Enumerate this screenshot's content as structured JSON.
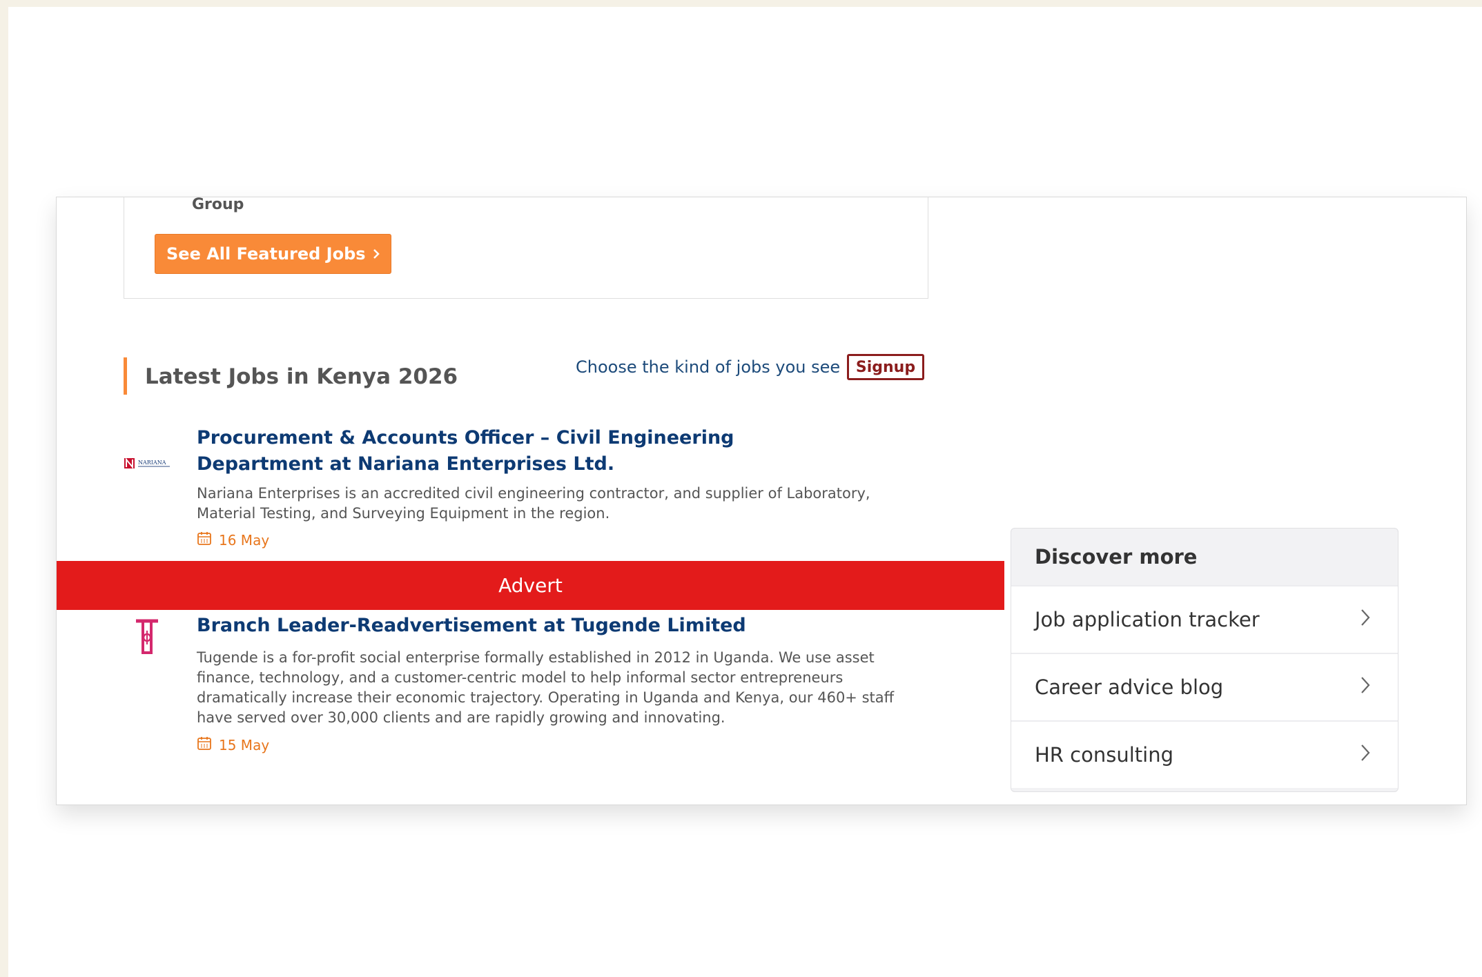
{
  "featured": {
    "company_tail": "Group",
    "see_all_label": "See All Featured Jobs"
  },
  "latest": {
    "title": "Latest Jobs in Kenya 2026",
    "choose_text": "Choose the kind of jobs you see",
    "signup_label": "Signup"
  },
  "jobs": [
    {
      "title": "Procurement & Accounts Officer – Civil Engineering Department at Nariana Enterprises Ltd.",
      "description": "Nariana Enterprises is an accredited civil engineering contractor, and supplier of Laboratory, Material Testing, and Surveying Equipment in the region.",
      "date": "16 May",
      "logo_text": "NARIANA"
    },
    {
      "title": "Branch Leader-Readvertisement at Tugende Limited",
      "description": "Tugende is a for-profit social enterprise formally established in 2012 in Uganda. We use asset finance, technology, and a customer-centric model to help informal sector entrepreneurs dramatically increase their economic trajectory. Operating in Uganda and Kenya, our 460+ staff have served over 30,000 clients and are rapidly growing and innovating.",
      "date": "15 May"
    }
  ],
  "advert": {
    "label": "Advert"
  },
  "discover": {
    "heading": "Discover more",
    "items": [
      {
        "label": "Job application tracker"
      },
      {
        "label": "Career advice blog"
      },
      {
        "label": "HR consulting"
      }
    ]
  },
  "colors": {
    "accent_orange": "#f98a38",
    "job_title_blue": "#0d3a73",
    "advert_red": "#e31b1b",
    "signup_maroon": "#8b1d1d"
  }
}
